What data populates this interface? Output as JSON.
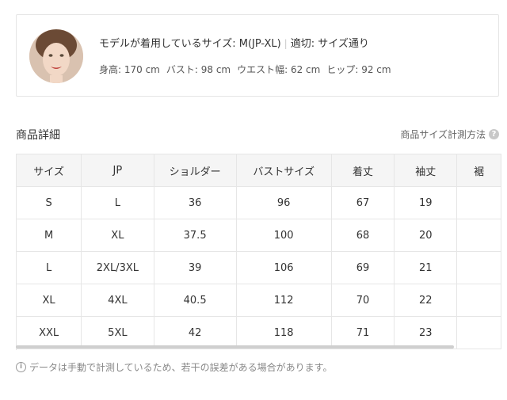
{
  "model": {
    "wearing_label": "モデルが着用しているサイズ: M(JP-XL)",
    "separator": "|",
    "fit_label": "適切: サイズ通り",
    "height": "身高: 170 cm",
    "bust": "バスト: 98 cm",
    "waist": "ウエスト幅: 62 cm",
    "hip": "ヒップ: 92 cm"
  },
  "section": {
    "title": "商品詳細",
    "size_guide_link": "商品サイズ計測方法",
    "help_icon": "?"
  },
  "table": {
    "headers": [
      "サイズ",
      "JP",
      "ショルダー",
      "バストサイズ",
      "着丈",
      "袖丈",
      "裾"
    ],
    "rows": [
      [
        "S",
        "L",
        "36",
        "96",
        "67",
        "19",
        ""
      ],
      [
        "M",
        "XL",
        "37.5",
        "100",
        "68",
        "20",
        ""
      ],
      [
        "L",
        "2XL/3XL",
        "39",
        "106",
        "69",
        "21",
        ""
      ],
      [
        "XL",
        "4XL",
        "40.5",
        "112",
        "70",
        "22",
        ""
      ],
      [
        "XXL",
        "5XL",
        "42",
        "118",
        "71",
        "23",
        ""
      ]
    ]
  },
  "note": {
    "icon": "i",
    "text": "データは手動で計測しているため、若干の誤差がある場合があります。"
  },
  "icons": {
    "help": "question-circle-icon",
    "info": "info-circle-icon"
  }
}
